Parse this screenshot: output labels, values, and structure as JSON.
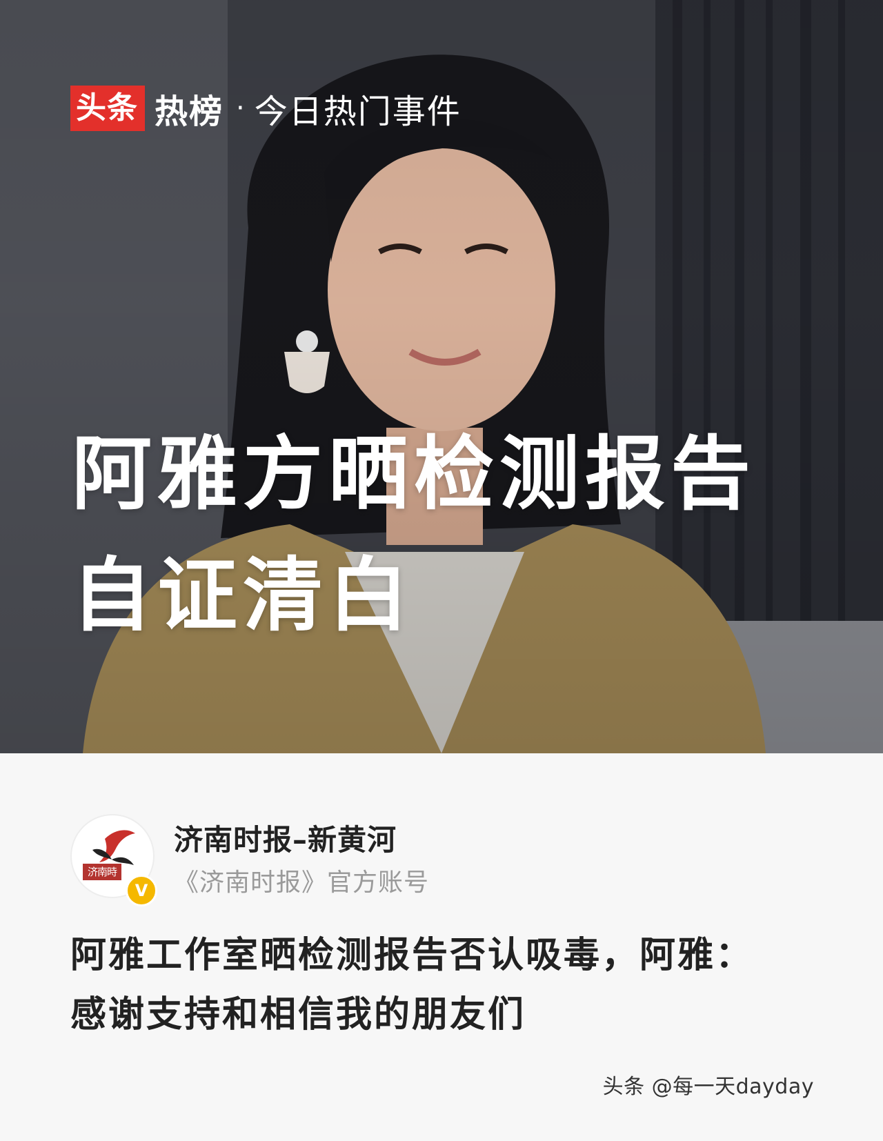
{
  "hero": {
    "brand_red": "头条",
    "brand_hot": "热榜",
    "brand_sep": "·",
    "brand_sub": "今日热门事件",
    "headline_line1": "阿雅方晒检测报告",
    "headline_line2": "自证清白"
  },
  "author": {
    "name": "济南时报–新黄河",
    "description": "《济南时报》官方账号",
    "avatar_seal": "济南時",
    "verified_badge": "V"
  },
  "article": {
    "title": "阿雅工作室晒检测报告否认吸毒，阿雅：感谢支持和相信我的朋友们"
  },
  "watermark": "头条 @每一天dayday",
  "colors": {
    "brand_red": "#e3302b",
    "verified_yellow": "#f5b800"
  },
  "icons": {
    "verified": "verified-v-badge"
  }
}
